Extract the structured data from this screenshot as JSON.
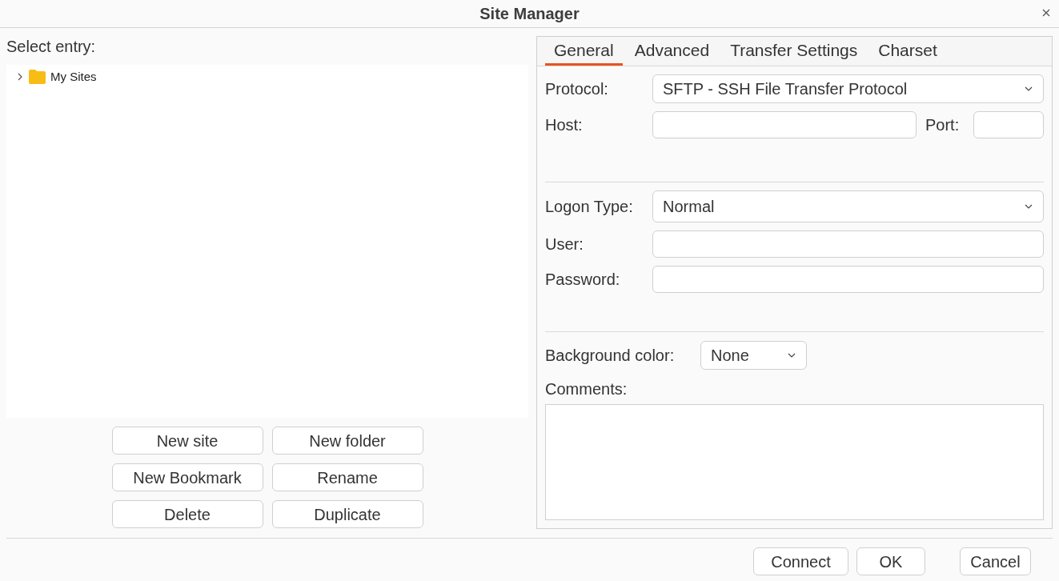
{
  "window": {
    "title": "Site Manager"
  },
  "tree": {
    "label": "Select entry:",
    "items": [
      {
        "label": "My Sites",
        "expanded": false
      }
    ]
  },
  "tree_buttons": [
    "New site",
    "New folder",
    "New Bookmark",
    "Rename",
    "Delete",
    "Duplicate"
  ],
  "tabs": [
    {
      "label": "General",
      "selected": true
    },
    {
      "label": "Advanced",
      "selected": false
    },
    {
      "label": "Transfer Settings",
      "selected": false
    },
    {
      "label": "Charset",
      "selected": false
    }
  ],
  "protocol": {
    "label": "Protocol:",
    "value": "SFTP - SSH File Transfer Protocol"
  },
  "host": {
    "label": "Host:"
  },
  "port": {
    "label": "Port:"
  },
  "logon_type": {
    "label": "Logon Type:",
    "value": "Normal"
  },
  "user": {
    "label": "User:"
  },
  "password": {
    "label": "Password:"
  },
  "background_color": {
    "label": "Background color:",
    "value": "None"
  },
  "comments": {
    "label": "Comments:"
  },
  "buttons": [
    "Connect",
    "OK",
    "Cancel"
  ]
}
